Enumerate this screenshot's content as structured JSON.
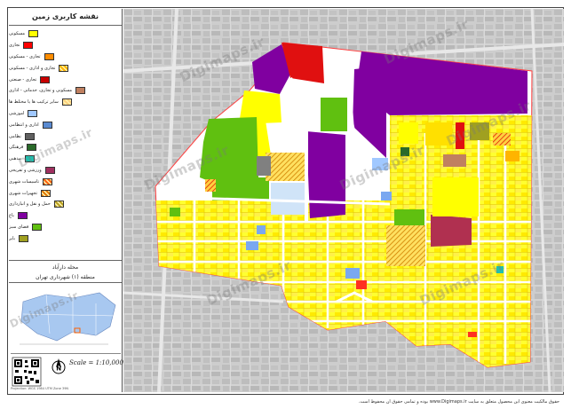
{
  "legend": {
    "title": "نقشه کاربری زمین",
    "items": [
      {
        "label": "مسکونی",
        "color": "#ffff00"
      },
      {
        "label": "تجاری",
        "color": "#ff0000"
      },
      {
        "label": "تجاری - مسکونی",
        "color": "#ff8c00"
      },
      {
        "label": "تجاری و اداری - مسکونی",
        "color": "#ffb400",
        "hatch": true
      },
      {
        "label": "تجاری - صنعتی",
        "color": "#c80000"
      },
      {
        "label": "مسکونی و تجاری، خدماتی - اداری",
        "color": "#c08060"
      },
      {
        "label": "سایر ترکیب ها یا مختلط ها",
        "color": "#ffd080",
        "hatch": true
      },
      {
        "label": "آموزشی",
        "color": "#a0c8ff"
      },
      {
        "label": "اداری و انتظامی",
        "color": "#5a8ad0"
      },
      {
        "label": "نظامی",
        "color": "#606060"
      },
      {
        "label": "فرهنگی",
        "color": "#2a6a2a"
      },
      {
        "label": "مذهبی",
        "color": "#20c0b0"
      },
      {
        "label": "ورزشی و تفریحی",
        "color": "#a03060"
      },
      {
        "label": "تاسیسات شهری",
        "color": "#ff6010",
        "hatch": true
      },
      {
        "label": "تجهیزات شهری",
        "color": "#e07800",
        "hatch": true
      },
      {
        "label": "حمل و نقل و انبارداری",
        "color": "#b8a020",
        "hatch": true
      },
      {
        "label": "باغ",
        "color": "#8000a0"
      },
      {
        "label": "فضای سبز",
        "color": "#60c010"
      },
      {
        "label": "بایر",
        "color": "#a0a020"
      }
    ]
  },
  "neighborhood": {
    "name": "محله دارآباد",
    "district": "منطقه (۱) شهرداری تهران"
  },
  "scale": "Scale = 1:10,000",
  "north_icon": "north-arrow-icon",
  "qr_icon": "qr-code-icon",
  "watermark": "Digimaps.ir",
  "footer": "حقوق مالکیت معنوی این محصول متعلق به سایت www.Digimaps.ir بوده و تمامی حقوق آن محفوظ است.",
  "footer_left": "Projection: WGS 1984 UTM Zone 39N"
}
